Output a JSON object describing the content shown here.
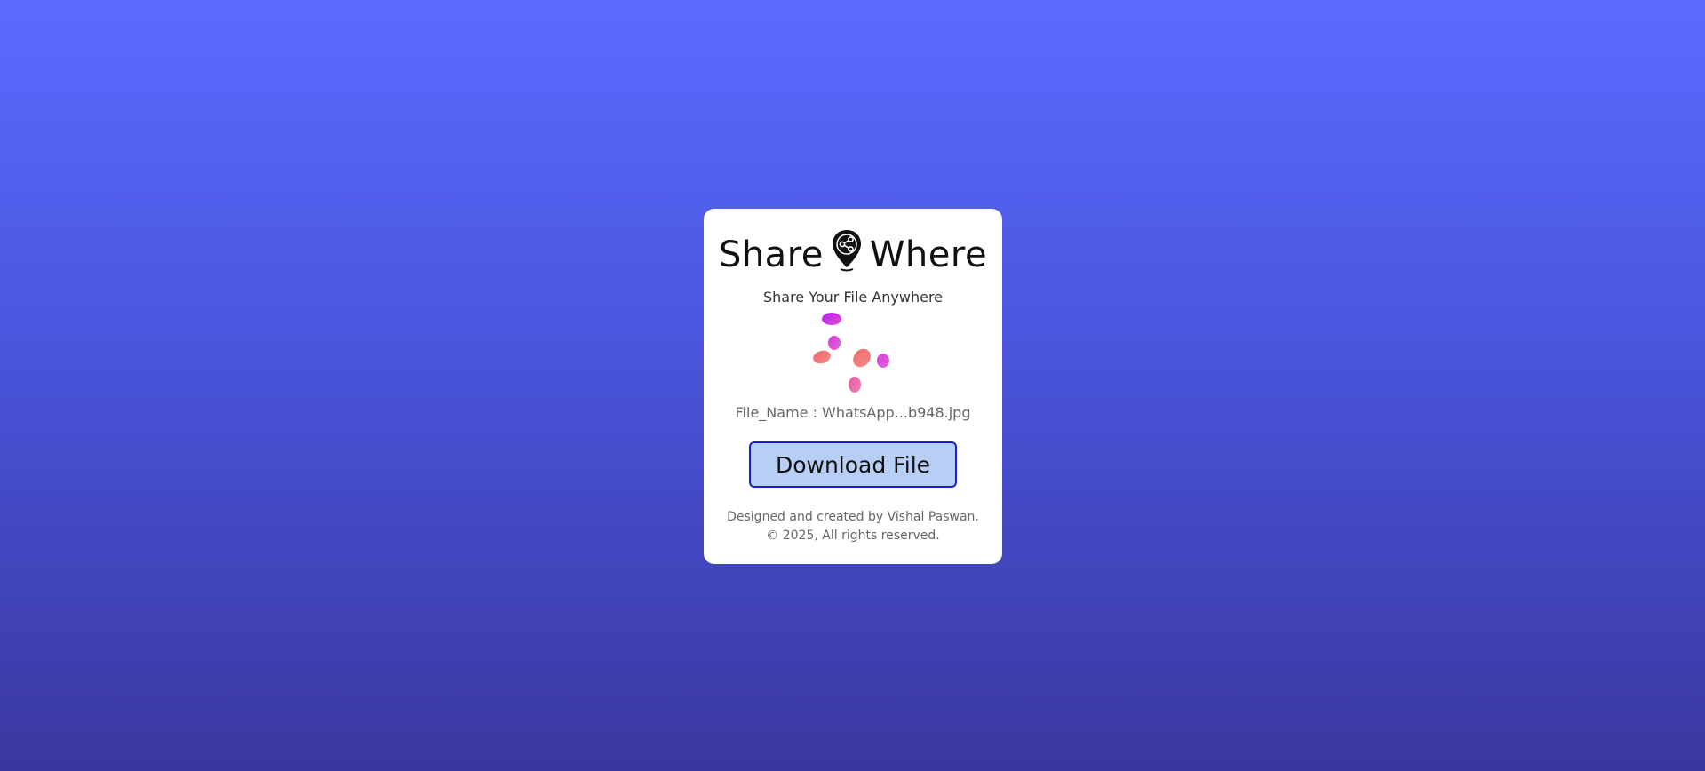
{
  "header": {
    "title_left": "Share",
    "title_right": "Where",
    "logo_icon": "location-pin-share-icon",
    "subtitle": "Share Your File Anywhere"
  },
  "loader": {
    "icon": "loading-blobs-icon",
    "colors": [
      "#c21ff0",
      "#d93ae0",
      "#f07a7a",
      "#e06fe0",
      "#f06a9a"
    ]
  },
  "file": {
    "label": "File_Name : WhatsApp...b948.jpg"
  },
  "actions": {
    "download_label": "Download File"
  },
  "footer": {
    "line1": "Designed and created by Vishal Paswan.",
    "line2": "© 2025, All rights reserved."
  },
  "colors": {
    "bg_top": "#5b6bff",
    "bg_bottom": "#3a379f",
    "button_bg": "#b8cff5",
    "button_border": "#1a1ad9"
  }
}
